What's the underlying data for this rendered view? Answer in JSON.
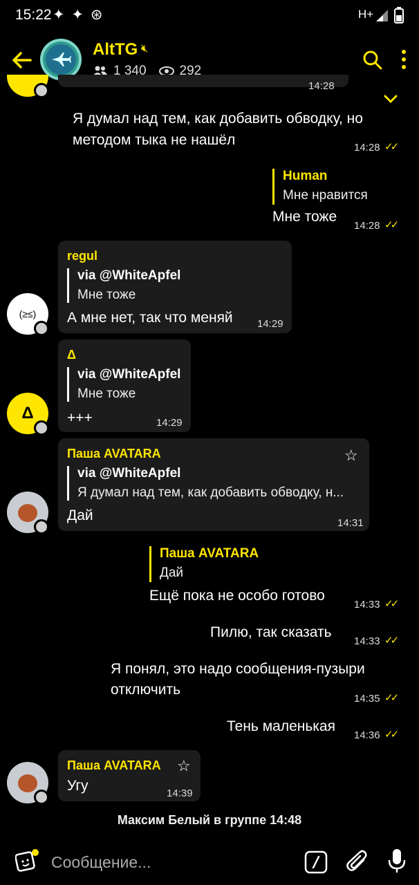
{
  "status": {
    "time": "15:22",
    "left_icons": "✦ ✦ ⊛",
    "network": "H+"
  },
  "header": {
    "title": "AltTG",
    "members": "1 340",
    "online": "292"
  },
  "partial_time": "14:28",
  "messages": {
    "out1": {
      "text_l1": "Я думал над тем, как добавить обводку, но",
      "text_l2": "методом тыка не нашёл",
      "time": "14:28"
    },
    "out2": {
      "quote_name": "Human",
      "quote_text": "Мне нравится",
      "text": "Мне тоже",
      "time": "14:28"
    },
    "in1": {
      "sender": "regul",
      "quote_name": "via @WhiteApfel",
      "quote_text": "Мне тоже",
      "text": "А мне нет, так что меняй",
      "time": "14:29",
      "avatar_glyph": "(≥≤)"
    },
    "in2": {
      "sender": "Δ",
      "quote_name": "via @WhiteApfel",
      "quote_text": "Мне тоже",
      "text": "+++",
      "time": "14:29",
      "avatar_glyph": "Δ"
    },
    "in3": {
      "sender": "Паша AVATARA",
      "quote_name": "via @WhiteApfel",
      "quote_text": "Я думал над тем, как добавить обводку, н...",
      "text": "Дай",
      "time": "14:31"
    },
    "out3": {
      "quote_name": "Паша AVATARA",
      "quote_text": "Дай",
      "text": "Ещё пока не особо готово",
      "time": "14:33"
    },
    "out4": {
      "text": "Пилю, так сказать",
      "time": "14:33"
    },
    "out5": {
      "text_l1": "Я понял, это надо сообщения-пузыри",
      "text_l2": "отключить",
      "time": "14:35"
    },
    "out6": {
      "text": "Тень маленькая",
      "time": "14:36"
    },
    "in4": {
      "sender": "Паша AVATARA",
      "text": "Угу",
      "time": "14:39"
    }
  },
  "system": {
    "text": "Максим Белый в группе  14:48"
  },
  "composer": {
    "placeholder": "Сообщение..."
  },
  "colors": {
    "accent": "#ffe600",
    "bubble": "#1c1c1c",
    "background": "#000000"
  }
}
